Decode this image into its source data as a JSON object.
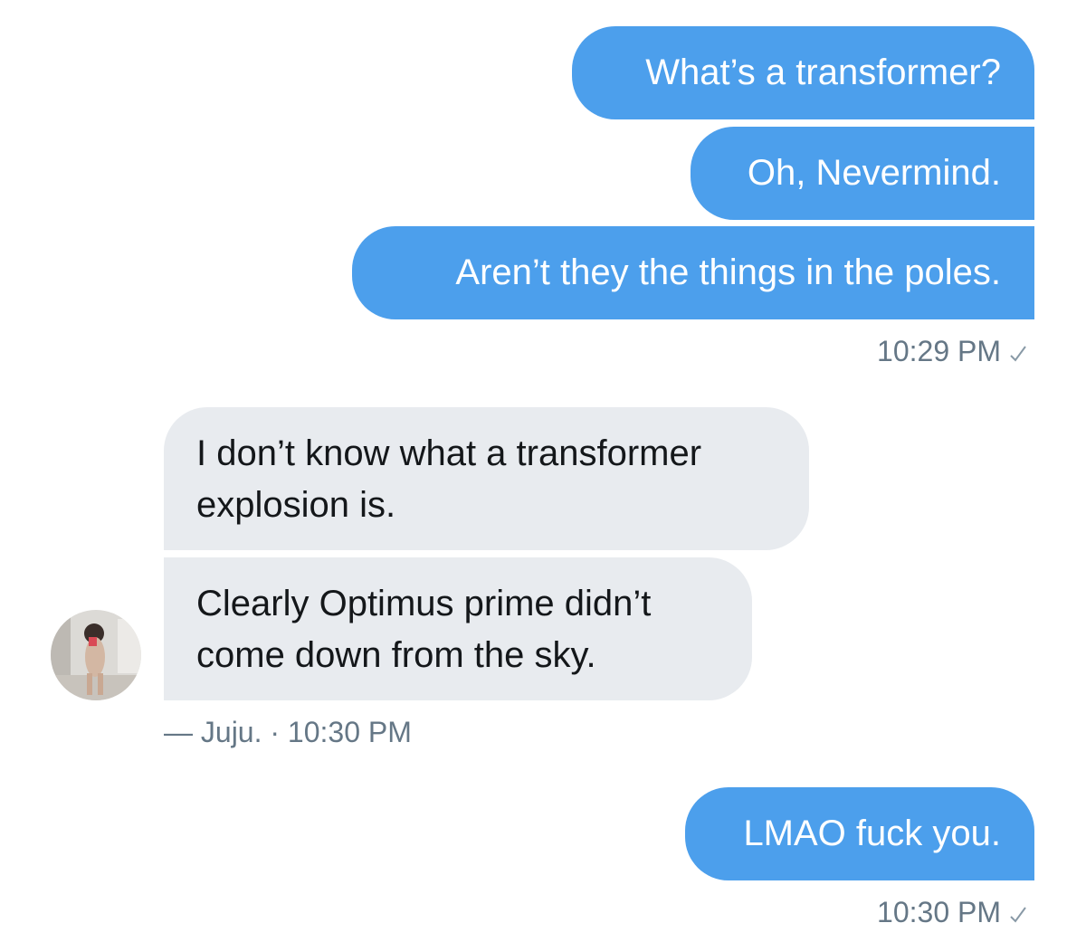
{
  "conversation": {
    "messages_group_1": [
      "What’s a transformer?",
      "Oh, Nevermind.",
      "Aren’t they the things in the poles."
    ],
    "timestamp_1": "10:29 PM",
    "received_messages": [
      {
        "line1": "I don’t know what a transformer",
        "line2": "explosion is."
      },
      {
        "line1": "Clearly Optimus prime didn’t",
        "line2": "come down from the sky."
      }
    ],
    "sender_line": "— Juju. · 10:30 PM",
    "messages_group_2": [
      "LMAO fuck you."
    ],
    "timestamp_2": "10:30 PM"
  },
  "colors": {
    "outgoing_bubble": "#4c9fec",
    "incoming_bubble": "#e8ebef",
    "meta_text": "#657786"
  },
  "icons": {
    "read_receipt": "checkmark-icon",
    "sender_avatar": "avatar"
  }
}
